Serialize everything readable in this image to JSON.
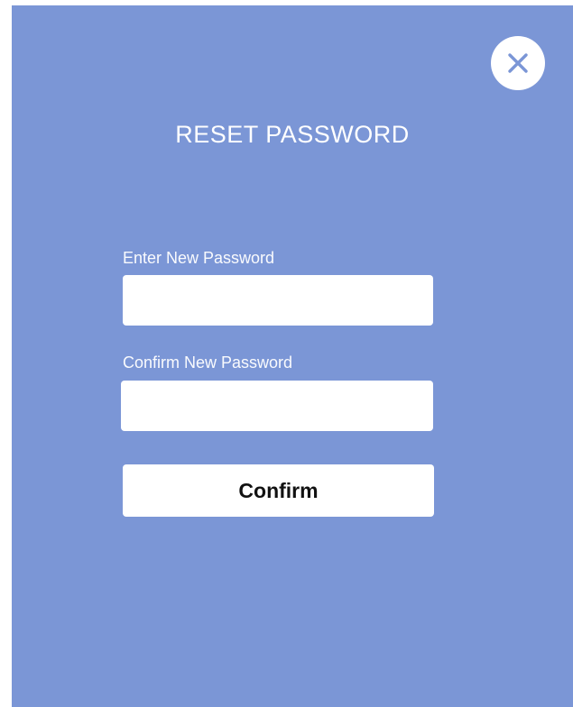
{
  "modal": {
    "title": "RESET PASSWORD",
    "background_color": "#7b96d6",
    "close_icon": "close-icon"
  },
  "form": {
    "new_password": {
      "label": "Enter New Password",
      "value": "",
      "placeholder": ""
    },
    "confirm_password": {
      "label": "Confirm New Password",
      "value": "",
      "placeholder": ""
    },
    "submit_label": "Confirm"
  }
}
